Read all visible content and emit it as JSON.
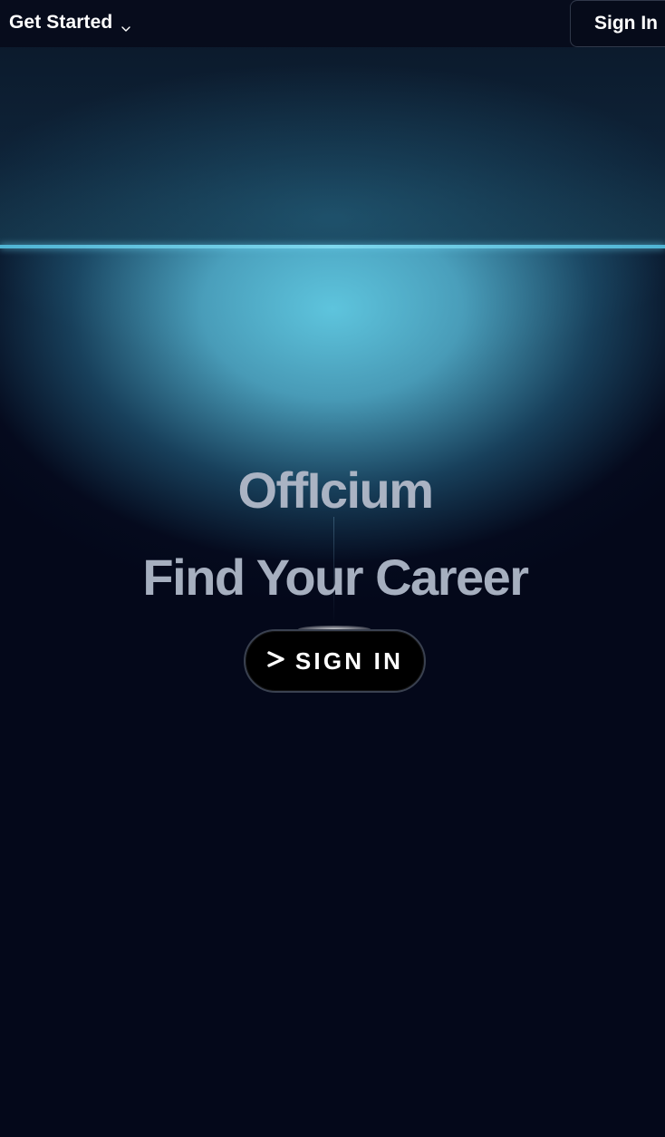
{
  "nav": {
    "menu_label": "Get Started",
    "menu_icon": "chevron-down-icon",
    "signin_label": "Sign In"
  },
  "hero": {
    "brand": "OffIcium",
    "tagline": "Find Your Career",
    "cta_label": "SIGN IN",
    "cta_icon": "chevron-right-icon"
  },
  "colors": {
    "background": "#04081a",
    "accent_glow": "#62cde6",
    "heading_text": "#aab3c3",
    "button_bg": "#000000",
    "button_text": "#ffffff"
  }
}
